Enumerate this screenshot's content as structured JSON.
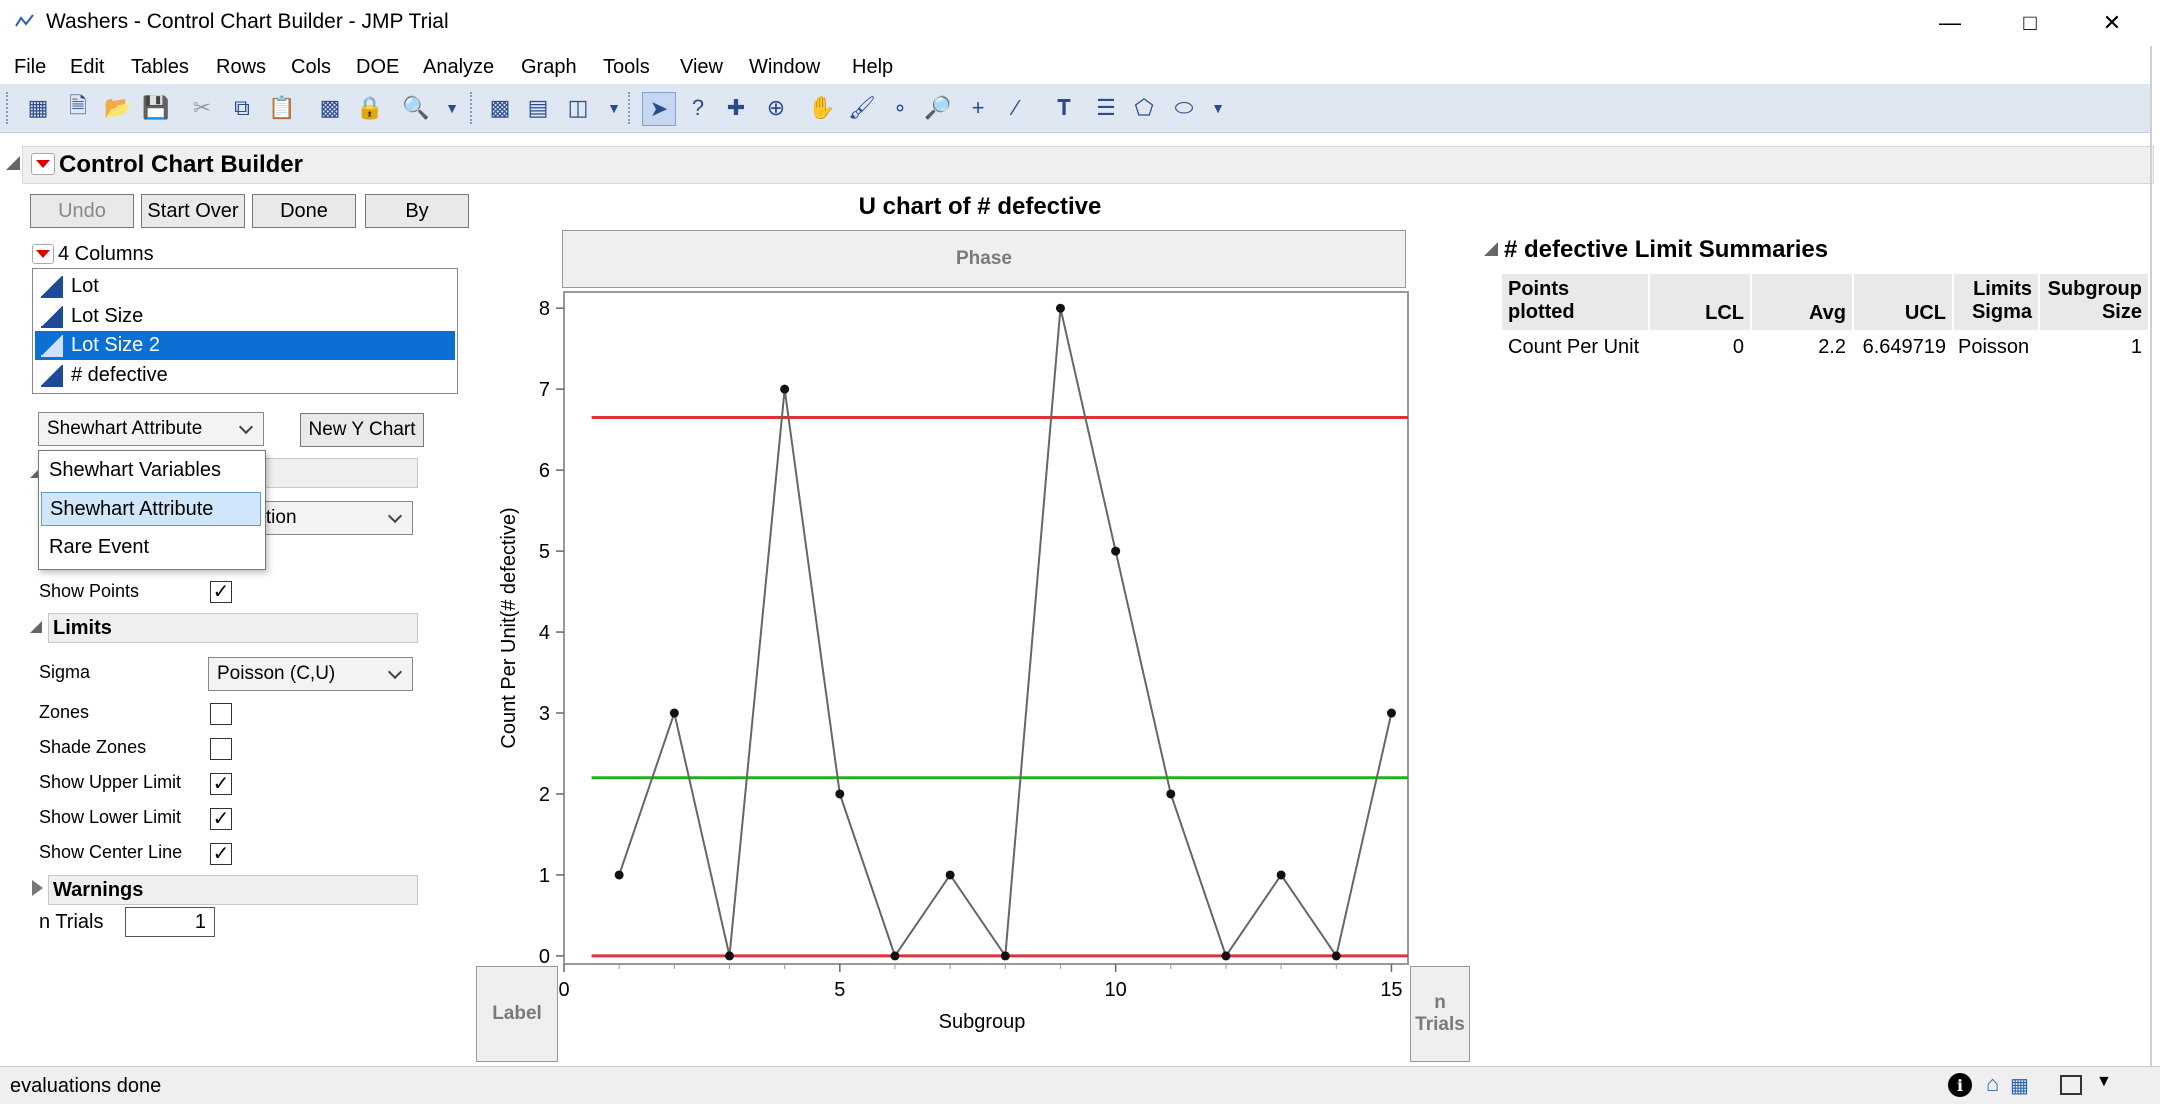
{
  "window": {
    "title": "Washers - Control Chart Builder - JMP Trial"
  },
  "menu": [
    "File",
    "Edit",
    "Tables",
    "Rows",
    "Cols",
    "DOE",
    "Analyze",
    "Graph",
    "Tools",
    "View",
    "Window",
    "Help"
  ],
  "panel": {
    "title": "Control Chart Builder",
    "buttons": {
      "undo": "Undo",
      "start_over": "Start Over",
      "done": "Done",
      "by": "By"
    },
    "columns_label": "4 Columns",
    "columns": [
      "Lot",
      "Lot Size",
      "Lot Size 2",
      "# defective"
    ],
    "selected_column": "Lot Size 2",
    "chart_type_combo": "Shewhart Attribute",
    "new_y_chart": "New Y Chart",
    "dropdown_options": [
      "Shewhart Variables",
      "Shewhart Attribute",
      "Rare Event"
    ],
    "hidden_combo_partial": "ortion",
    "show_points": {
      "label": "Show Points",
      "checked": true
    },
    "limits_section": "Limits",
    "sigma": {
      "label": "Sigma",
      "value": "Poisson (C,U)"
    },
    "options": [
      {
        "label": "Zones",
        "checked": false
      },
      {
        "label": "Shade Zones",
        "checked": false
      },
      {
        "label": "Show Upper Limit",
        "checked": true
      },
      {
        "label": "Show Lower Limit",
        "checked": true
      },
      {
        "label": "Show Center Line",
        "checked": true
      }
    ],
    "warnings_section": "Warnings",
    "n_trials": {
      "label": "n Trials",
      "value": "1"
    }
  },
  "chart": {
    "title": "U chart of # defective",
    "phase_zone": "Phase",
    "label_zone": "Label",
    "n_trials_zone_1": "n",
    "n_trials_zone_2": "Trials"
  },
  "chart_data": {
    "type": "line",
    "title": "U chart of # defective",
    "xlabel": "Subgroup",
    "ylabel": "Count Per Unit(# defective)",
    "x": [
      1,
      2,
      3,
      4,
      5,
      6,
      7,
      8,
      9,
      10,
      11,
      12,
      13,
      14,
      15
    ],
    "series": [
      {
        "values": [
          1,
          3,
          0,
          7,
          2,
          0,
          1,
          0,
          8,
          5,
          2,
          0,
          1,
          0,
          3
        ]
      }
    ],
    "limits": {
      "LCL": 0,
      "Avg": 2.2,
      "UCL": 6.649719
    },
    "xlim": [
      0,
      15.3
    ],
    "ylim": [
      -0.1,
      8.2
    ],
    "xticks": [
      0,
      5,
      10,
      15
    ],
    "yticks": [
      0,
      1,
      2,
      3,
      4,
      5,
      6,
      7,
      8
    ],
    "colors": {
      "limit": "#e0303a",
      "center": "#22b022",
      "line": "#666666"
    }
  },
  "limit_summaries": {
    "title": "# defective Limit Summaries",
    "headers": [
      [
        "Points",
        "plotted"
      ],
      [
        "",
        "LCL"
      ],
      [
        "",
        "Avg"
      ],
      [
        "",
        "UCL"
      ],
      [
        "Limits",
        "Sigma"
      ],
      [
        "Subgroup",
        "Size"
      ]
    ],
    "rows": [
      [
        "Count Per Unit",
        "0",
        "2.2",
        "6.649719",
        "Poisson",
        "1"
      ]
    ]
  },
  "status": {
    "text": "evaluations done"
  }
}
